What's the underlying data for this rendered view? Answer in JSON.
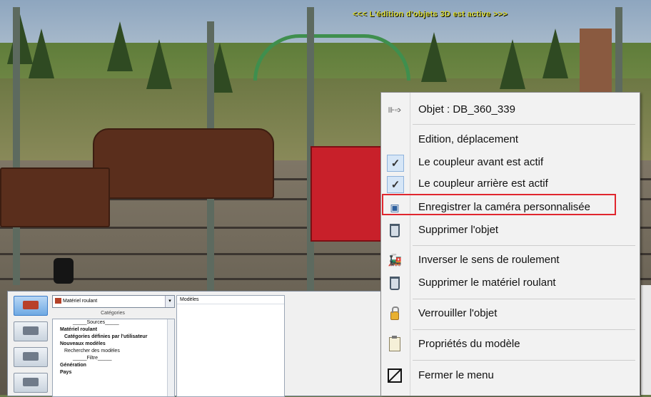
{
  "banner": "<<<  L'édition d'objets 3D est active  >>>",
  "context_menu": {
    "header": "Objet : DB_360_339",
    "items": {
      "edit": "Edition, déplacement",
      "front_coupler": "Le coupleur avant est actif",
      "rear_coupler": "Le coupleur arrière est actif",
      "save_camera": "Enregistrer la caméra personnalisée",
      "delete_object": "Supprimer l'objet",
      "reverse_direction": "Inverser le sens de roulement",
      "delete_rolling_stock": "Supprimer le matériel roulant",
      "lock_object": "Verrouiller l'objet",
      "model_properties": "Propriétés du modèle",
      "close_menu": "Fermer le menu"
    },
    "icons": {
      "header": "loco-arrow-icon",
      "front_coupler": "checkmark-icon",
      "rear_coupler": "checkmark-icon",
      "save_camera": "camera-save-icon",
      "delete_object": "trash-icon",
      "reverse_direction": "locomotive-icon",
      "delete_rolling_stock": "trash-icon",
      "lock_object": "padlock-icon",
      "model_properties": "clipboard-icon",
      "close_menu": "close-box-icon"
    },
    "highlight_color": "#e0262e"
  },
  "panel": {
    "combo_value": "Matériel roulant",
    "categories_label": "Catégories",
    "models_header": "Modèles",
    "tree": [
      "_____Sources_____",
      "Matériel roulant",
      "Catégories définies par l'utilisateur",
      "Nouveaux modèles",
      "Rechercher des modèles",
      "_____Filtre_____",
      "Génération",
      "Pays"
    ]
  }
}
